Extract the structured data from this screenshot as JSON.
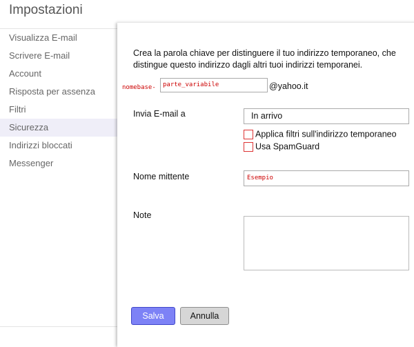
{
  "page": {
    "title": "Impostazioni"
  },
  "sidebar": {
    "items": [
      {
        "label": "Visualizza E-mail"
      },
      {
        "label": "Scrivere E-mail"
      },
      {
        "label": "Account"
      },
      {
        "label": "Risposta per assenza"
      },
      {
        "label": "Filtri"
      },
      {
        "label": "Sicurezza",
        "active": true
      },
      {
        "label": "Indirizzi bloccati"
      },
      {
        "label": "Messenger"
      }
    ]
  },
  "form": {
    "description": "Crea la parola chiave per distinguere il tuo indirizzo temporaneo, che distingue questo indirizzo dagli altri tuoi indirizzi temporanei.",
    "base_name": "nomebase-",
    "variable_part": "parte_variabile",
    "domain": "@yahoo.it",
    "send_to_label": "Invia E-mail a",
    "send_to_value": "In arrivo",
    "apply_filters_label": "Applica filtri sull'indirizzo temporaneo",
    "spamguard_label": "Usa SpamGuard",
    "sender_label": "Nome mittente",
    "sender_value": "Esempio",
    "note_label": "Note",
    "note_value": ""
  },
  "buttons": {
    "save": "Salva",
    "cancel": "Annulla"
  },
  "colors": {
    "accent": "#7d82f6",
    "active_item_bg": "#efeef8",
    "warning": "#cc0000"
  }
}
